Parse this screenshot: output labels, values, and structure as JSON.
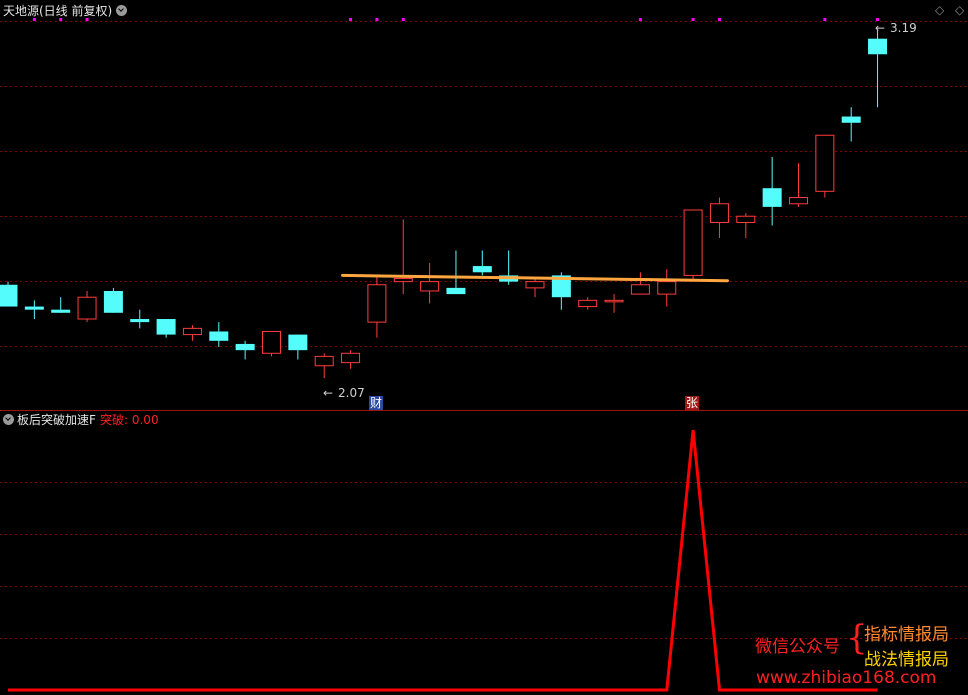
{
  "main_panel": {
    "title": "天地源(日线 前复权)",
    "high_label": "3.19",
    "low_label": "2.07",
    "marker_cai": "财",
    "marker_zhang": "张"
  },
  "sub_panel": {
    "title": "板后突破加速F",
    "value_label": "突破: 0.00"
  },
  "watermark": {
    "line1": "微信公众号",
    "brand1": "指标情报局",
    "brand2": "战法情报局",
    "url": "www.zhibiao168.com"
  },
  "colors": {
    "up": "#ff3c3c",
    "down": "#54fcfc",
    "grid": "#800000",
    "trendline": "#ffa640",
    "signal": "#ff0000",
    "dots": "#ff00ff",
    "watermark_red": "#ff2020",
    "watermark_yellow": "#ffd200"
  },
  "chart_data": [
    {
      "type": "candlestick",
      "ylim": [
        2.0,
        3.22
      ],
      "candles": [
        {
          "o": 2.37,
          "h": 2.38,
          "l": 2.3,
          "c": 2.3
        },
        {
          "o": 2.3,
          "h": 2.32,
          "l": 2.26,
          "c": 2.29
        },
        {
          "o": 2.29,
          "h": 2.33,
          "l": 2.28,
          "c": 2.28
        },
        {
          "o": 2.26,
          "h": 2.35,
          "l": 2.25,
          "c": 2.33
        },
        {
          "o": 2.35,
          "h": 2.36,
          "l": 2.28,
          "c": 2.28
        },
        {
          "o": 2.26,
          "h": 2.29,
          "l": 2.23,
          "c": 2.25
        },
        {
          "o": 2.26,
          "h": 2.26,
          "l": 2.2,
          "c": 2.21
        },
        {
          "o": 2.21,
          "h": 2.24,
          "l": 2.19,
          "c": 2.23
        },
        {
          "o": 2.22,
          "h": 2.25,
          "l": 2.17,
          "c": 2.19
        },
        {
          "o": 2.18,
          "h": 2.19,
          "l": 2.13,
          "c": 2.16
        },
        {
          "o": 2.15,
          "h": 2.22,
          "l": 2.14,
          "c": 2.22
        },
        {
          "o": 2.21,
          "h": 2.21,
          "l": 2.13,
          "c": 2.16
        },
        {
          "o": 2.11,
          "h": 2.15,
          "l": 2.07,
          "c": 2.14
        },
        {
          "o": 2.12,
          "h": 2.16,
          "l": 2.1,
          "c": 2.15
        },
        {
          "o": 2.25,
          "h": 2.4,
          "l": 2.2,
          "c": 2.37
        },
        {
          "o": 2.38,
          "h": 2.58,
          "l": 2.34,
          "c": 2.39
        },
        {
          "o": 2.35,
          "h": 2.44,
          "l": 2.31,
          "c": 2.38
        },
        {
          "o": 2.36,
          "h": 2.48,
          "l": 2.34,
          "c": 2.34
        },
        {
          "o": 2.43,
          "h": 2.48,
          "l": 2.4,
          "c": 2.41
        },
        {
          "o": 2.4,
          "h": 2.48,
          "l": 2.37,
          "c": 2.38
        },
        {
          "o": 2.36,
          "h": 2.39,
          "l": 2.33,
          "c": 2.38
        },
        {
          "o": 2.4,
          "h": 2.41,
          "l": 2.29,
          "c": 2.33
        },
        {
          "o": 2.3,
          "h": 2.33,
          "l": 2.29,
          "c": 2.32
        },
        {
          "o": 2.32,
          "h": 2.34,
          "l": 2.28,
          "c": 2.32
        },
        {
          "o": 2.34,
          "h": 2.41,
          "l": 2.34,
          "c": 2.37
        },
        {
          "o": 2.34,
          "h": 2.42,
          "l": 2.3,
          "c": 2.38
        },
        {
          "o": 2.4,
          "h": 2.61,
          "l": 2.38,
          "c": 2.61
        },
        {
          "o": 2.57,
          "h": 2.65,
          "l": 2.52,
          "c": 2.63
        },
        {
          "o": 2.57,
          "h": 2.6,
          "l": 2.52,
          "c": 2.59
        },
        {
          "o": 2.68,
          "h": 2.78,
          "l": 2.56,
          "c": 2.62
        },
        {
          "o": 2.63,
          "h": 2.76,
          "l": 2.62,
          "c": 2.65
        },
        {
          "o": 2.67,
          "h": 2.85,
          "l": 2.65,
          "c": 2.85
        },
        {
          "o": 2.91,
          "h": 2.94,
          "l": 2.83,
          "c": 2.89
        },
        {
          "o": 3.16,
          "h": 3.19,
          "l": 2.94,
          "c": 3.11
        }
      ],
      "trendline": {
        "from_index": 13,
        "to_index": 27,
        "y_start": 2.4,
        "y_end": 2.383
      },
      "top_dot_indices": [
        1,
        2,
        3,
        13,
        14,
        15,
        24,
        26,
        27,
        31,
        33
      ],
      "markers": [
        {
          "index": 14,
          "text_key": "marker_cai"
        },
        {
          "index": 26,
          "text_key": "marker_zhang"
        }
      ],
      "high_annotation_index": 33,
      "low_annotation_index": 12
    },
    {
      "type": "line",
      "name": "突破",
      "ylim": [
        0,
        1.1
      ],
      "values": [
        0,
        0,
        0,
        0,
        0,
        0,
        0,
        0,
        0,
        0,
        0,
        0,
        0,
        0,
        0,
        0,
        0,
        0,
        0,
        0,
        0,
        0,
        0,
        0,
        0,
        0,
        1,
        0,
        0,
        0,
        0,
        0,
        0,
        0
      ]
    }
  ]
}
